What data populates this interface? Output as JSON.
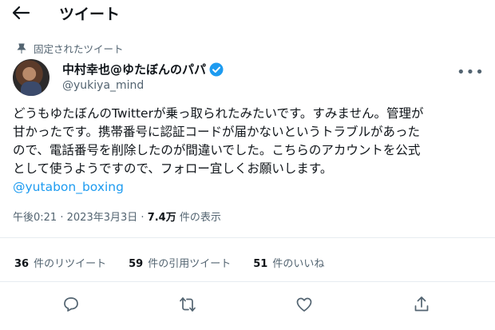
{
  "header": {
    "title": "ツイート"
  },
  "pinned": {
    "label": "固定されたツイート"
  },
  "user": {
    "display_name": "中村幸也@ゆたぼんのパパ",
    "handle": "@yukiya_mind"
  },
  "tweet": {
    "lines": [
      "どうもゆたぼんのTwitterが乗っ取られたみたいです。すみません。管理が",
      "甘かったです。携帯番号に認証コードが届かないというトラブルがあった",
      "ので、電話番号を削除したのが間違いでした。こちらのアカウントを公式",
      "として使うようですので、フォロー宜しくお願いします。"
    ],
    "mention": "@yutabon_boxing"
  },
  "meta": {
    "time": "午後0:21",
    "sep": "·",
    "date": "2023年3月3日",
    "views": "7.4万",
    "views_label": "件の表示"
  },
  "stats": [
    {
      "count": "36",
      "label": "件のリツイート"
    },
    {
      "count": "59",
      "label": "件の引用ツイート"
    },
    {
      "count": "51",
      "label": "件のいいね"
    }
  ],
  "actions": [
    "reply-icon",
    "retweet-icon",
    "like-icon",
    "share-icon"
  ],
  "colors": {
    "accent": "#1d9bf0",
    "secondary_text": "#536471",
    "divider": "#e6ecf0"
  }
}
